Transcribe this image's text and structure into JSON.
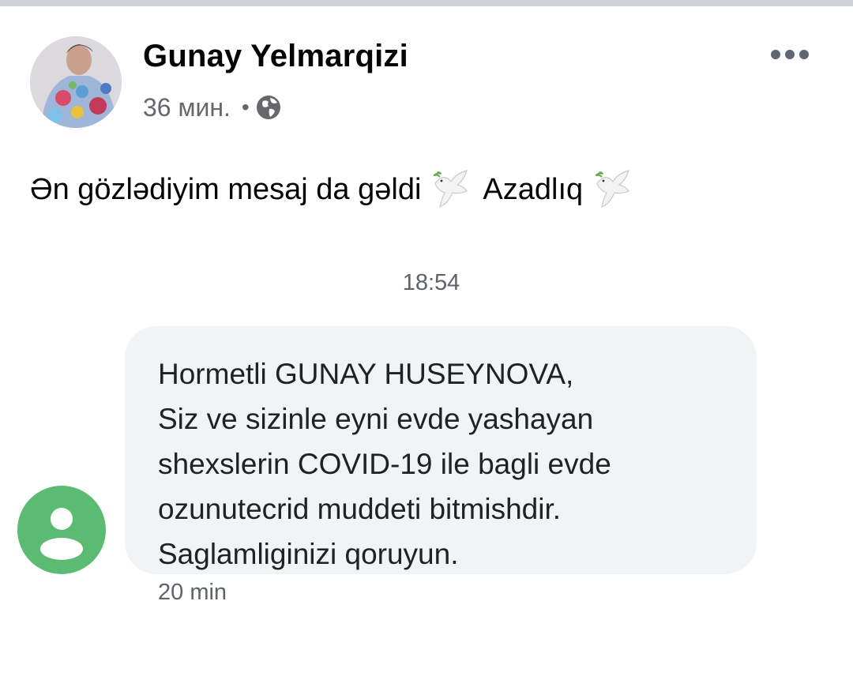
{
  "post": {
    "author_name": "Gunay Yelmarqizi",
    "timestamp": "36 мин.",
    "separator": "•",
    "audience_icon": "globe-icon",
    "more_icon": "more-options-icon",
    "text_part1": "Ən gözlədiyim mesaj da gəldi",
    "text_part2": "Azadlıq",
    "emoji_icon": "dove-icon"
  },
  "sms": {
    "time": "18:54",
    "sender_icon": "person-icon",
    "sender_color": "#5bbb72",
    "lines": [
      "Hormetli GUNAY HUSEYNOVA,",
      "Siz ve sizinle eyni evde yashayan",
      "shexslerin COVID-19 ile bagli evde",
      "ozunutecrid muddeti bitmishdir.",
      "Saglamliginizi qoruyun."
    ],
    "ago": "20 min"
  }
}
